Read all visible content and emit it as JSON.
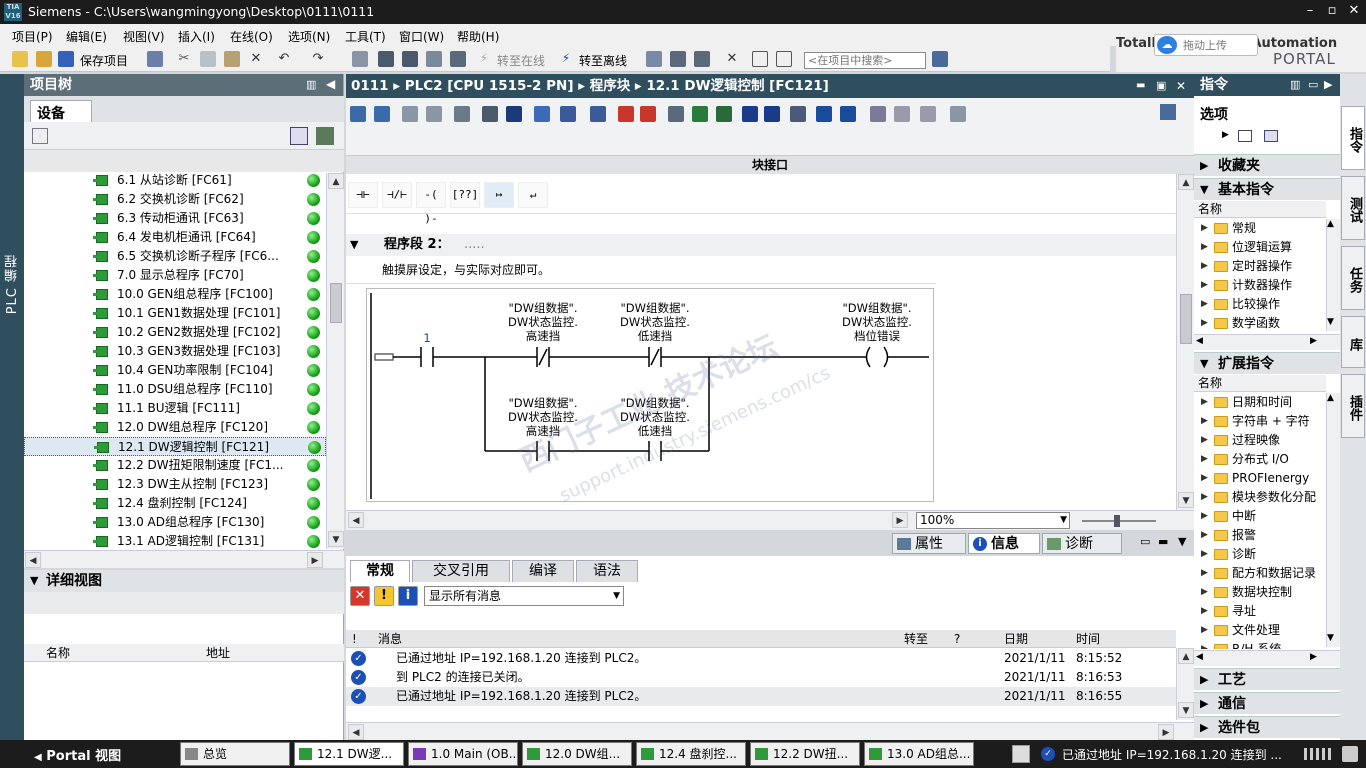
{
  "window": {
    "title": "Siemens  -  C:\\Users\\wangmingyong\\Desktop\\0111\\0111",
    "logo": "TIA V16"
  },
  "menu": [
    "项目(P)",
    "编辑(E)",
    "视图(V)",
    "插入(I)",
    "在线(O)",
    "选项(N)",
    "工具(T)",
    "窗口(W)",
    "帮助(H)"
  ],
  "brand": {
    "line1": "Totally Integrated Automation",
    "line2": "PORTAL",
    "cloud_label": "拖动上传"
  },
  "toolbar": {
    "save_project": "保存项目",
    "go_online": "转至在线",
    "go_offline": "转至离线",
    "search_placeholder": "<在项目中搜索>"
  },
  "left_vtab": "PLC 编程",
  "project_tree": {
    "title": "项目树",
    "tab": "设备",
    "items": [
      "6.1 从站诊断 [FC61]",
      "6.2 交换机诊断 [FC62]",
      "6.3 传动柜通讯 [FC63]",
      "6.4 发电机柜通讯 [FC64]",
      "6.5 交换机诊断子程序 [FC6...",
      "7.0 显示总程序 [FC70]",
      "10.0 GEN组总程序 [FC100]",
      "10.1 GEN1数据处理 [FC101]",
      "10.2 GEN2数据处理 [FC102]",
      "10.3 GEN3数据处理 [FC103]",
      "10.4 GEN功率限制 [FC104]",
      "11.0 DSU组总程序 [FC110]",
      "11.1 BU逻辑 [FC111]",
      "12.0 DW组总程序 [FC120]",
      "12.1 DW逻辑控制 [FC121]",
      "12.2 DW扭矩限制速度 [FC1...",
      "12.3 DW主从控制 [FC123]",
      "12.4 盘刹控制 [FC124]",
      "13.0 AD组总程序 [FC130]",
      "13.1 AD逻辑控制 [FC131]"
    ],
    "selected_index": 14
  },
  "details": {
    "title": "详细视图",
    "col_name": "名称",
    "col_address": "地址"
  },
  "editor": {
    "breadcrumb": "0111  ▸  PLC2 [CPU 1515-2 PN]  ▸  程序块  ▸  12.1 DW逻辑控制 [FC121]",
    "interface_label": "块接口",
    "ladder_tools": [
      "⊣⊢",
      "⊣/⊢",
      "-( )-",
      "[??]",
      "↦",
      "↵"
    ],
    "segment_title": "程序段 2：",
    "segment_dots": ".....",
    "segment_comment": "触摸屏设定，与实际对应即可。",
    "contact_const": "1",
    "contacts": {
      "c1": [
        "\"DW组数据\".",
        "DW状态监控.",
        "高速挡"
      ],
      "c2": [
        "\"DW组数据\".",
        "DW状态监控.",
        "低速挡"
      ],
      "c3": [
        "\"DW组数据\".",
        "DW状态监控.",
        "高速挡"
      ],
      "c4": [
        "\"DW组数据\".",
        "DW状态监控.",
        "低速挡"
      ],
      "coil": [
        "\"DW组数据\".",
        "DW状态监控.",
        "档位错误"
      ]
    },
    "watermark": "西门子工业  技术论坛",
    "watermark_url": "support.industry.siemens.com/cs",
    "zoom": "100%"
  },
  "info_tabs": {
    "properties": "属性",
    "info": "信息",
    "diagnostics": "诊断"
  },
  "info": {
    "subtabs": [
      "常规",
      "交叉引用",
      "编译",
      "语法"
    ],
    "filter": "显示所有消息",
    "columns": {
      "excl": "!",
      "message": "消息",
      "goto": "转至",
      "q": "?",
      "date": "日期",
      "time": "时间"
    },
    "messages": [
      {
        "text": "已通过地址 IP=192.168.1.20 连接到 PLC2。",
        "date": "2021/1/11",
        "time": "8:15:52"
      },
      {
        "text": "到 PLC2 的连接已关闭。",
        "date": "2021/1/11",
        "time": "8:16:53"
      },
      {
        "text": "已通过地址 IP=192.168.1.20 连接到 PLC2。",
        "date": "2021/1/11",
        "time": "8:16:55"
      }
    ]
  },
  "instructions": {
    "title": "指令",
    "options": "选项",
    "favorites": "收藏夹",
    "basic": "基本指令",
    "col_name": "名称",
    "basic_items": [
      "常规",
      "位逻辑运算",
      "定时器操作",
      "计数器操作",
      "比较操作",
      "数学函数"
    ],
    "extended": "扩展指令",
    "extended_items": [
      "日期和时间",
      "字符串 + 字符",
      "过程映像",
      "分布式 I/O",
      "PROFIenergy",
      "模块参数化分配",
      "中断",
      "报警",
      "诊断",
      "配方和数据记录",
      "数据块控制",
      "寻址",
      "文件处理",
      "R/H 系统"
    ],
    "tech": "工艺",
    "comm": "通信",
    "options_pkg": "选件包"
  },
  "right_vtabs": [
    "指令",
    "测试",
    "任务",
    "库",
    "插件"
  ],
  "taskbar": {
    "portal": "Portal 视图",
    "tasks": [
      "总览",
      "12.1 DW逻...",
      "1.0 Main (OB...",
      "12.0 DW组...",
      "12.4 盘刹控...",
      "12.2 DW扭...",
      "13.0 AD组总..."
    ],
    "status": "已通过地址 IP=192.168.1.20 连接到 ..."
  },
  "colors": {
    "header": "#2f4f5f",
    "green": "#1aa31a",
    "accent": "#1c4fb8"
  }
}
